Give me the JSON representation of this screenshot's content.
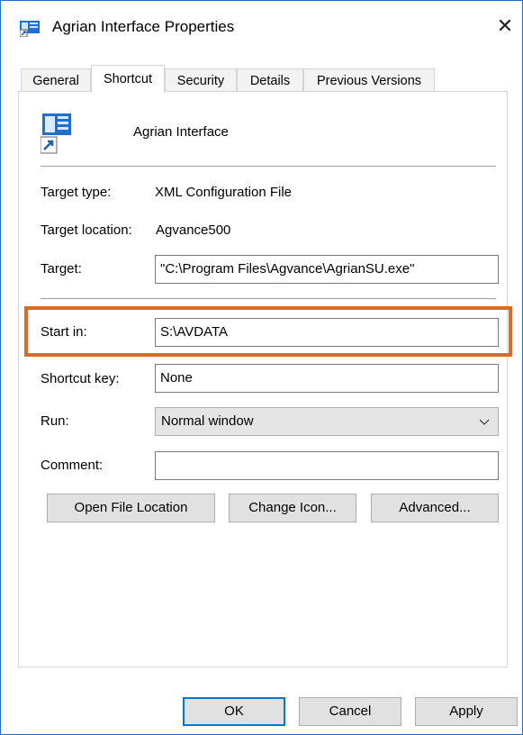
{
  "window": {
    "title": "Agrian Interface Properties",
    "close_glyph": "✕"
  },
  "tabs": [
    {
      "label": "General",
      "active": false
    },
    {
      "label": "Shortcut",
      "active": true
    },
    {
      "label": "Security",
      "active": false
    },
    {
      "label": "Details",
      "active": false
    },
    {
      "label": "Previous Versions",
      "active": false
    }
  ],
  "shortcut": {
    "name": "Agrian Interface",
    "icon": "shortcut-icon",
    "target_type_label": "Target type:",
    "target_type_value": "XML Configuration File",
    "target_location_label": "Target location:",
    "target_location_value": "Agvance500",
    "target_label": "Target:",
    "target_value": "\"C:\\Program Files\\Agvance\\AgrianSU.exe\"",
    "start_in_label": "Start in:",
    "start_in_value": "S:\\AVDATA",
    "shortcut_key_label": "Shortcut key:",
    "shortcut_key_value": "None",
    "run_label": "Run:",
    "run_value": "Normal window",
    "comment_label": "Comment:",
    "comment_value": ""
  },
  "buttons": {
    "open_file_location": "Open File Location",
    "change_icon": "Change Icon...",
    "advanced": "Advanced...",
    "ok": "OK",
    "cancel": "Cancel",
    "apply": "Apply"
  },
  "colors": {
    "highlight": "#d96b26",
    "accent": "#0078d7",
    "window_border": "#1c6ec9"
  }
}
